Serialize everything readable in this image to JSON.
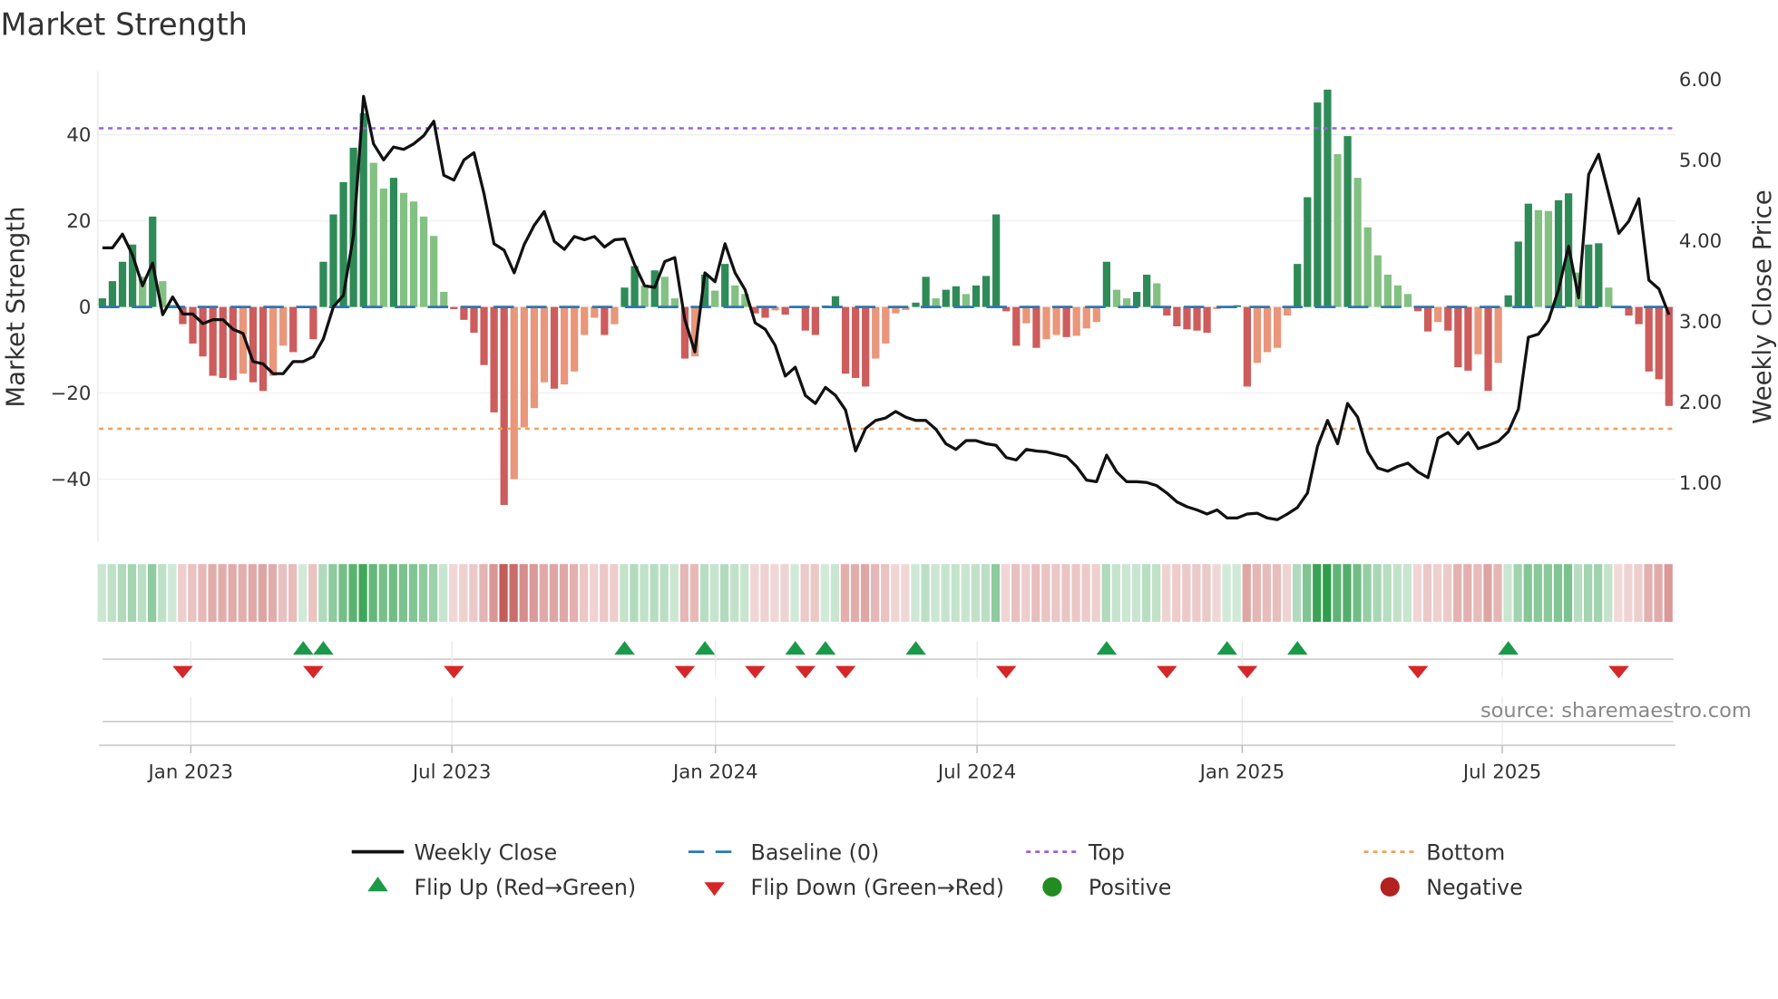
{
  "chart_data": {
    "type": "bar",
    "title": "Market Strength",
    "ylabel": "Market Strength",
    "y2label": "Weekly Close Price",
    "ylim": [
      -55,
      54
    ],
    "y2lim": [
      0.25,
      6.2
    ],
    "y_ticks": [
      "40",
      "20",
      "0",
      "−20",
      "−40"
    ],
    "y_tick_values": [
      40,
      20,
      0,
      -20,
      -40
    ],
    "y2_ticks": [
      "6.00",
      "5.00",
      "4.00",
      "3.00",
      "2.00",
      "1.00"
    ],
    "y2_tick_values": [
      6,
      5,
      4,
      3,
      2,
      1
    ],
    "x_unit": "week index",
    "x_ticks": [
      {
        "label": "Jan 2023",
        "week": 8.8
      },
      {
        "label": "Jul 2023",
        "week": 34.8
      },
      {
        "label": "Jan 2024",
        "week": 61.05
      },
      {
        "label": "Jul 2024",
        "week": 87.1
      },
      {
        "label": "Jan 2025",
        "week": 113.5
      },
      {
        "label": "Jul 2025",
        "week": 139.4
      }
    ],
    "top_level": 41.5,
    "bottom_level": -28.3,
    "baseline": 0,
    "strength": [
      2,
      6,
      10.5,
      14.5,
      7,
      21,
      6,
      0.5,
      -4,
      -8.5,
      -11.5,
      -16,
      -16.5,
      -17,
      -15.5,
      -17.5,
      -19.5,
      -16,
      -9,
      -10.5,
      0.2,
      -7.5,
      10.5,
      21.5,
      29,
      37,
      45,
      33.5,
      27.5,
      30,
      26.5,
      24.5,
      21,
      16.5,
      3.5,
      -0.5,
      -3,
      -6,
      -13.5,
      -24.5,
      -46,
      -40,
      -28,
      -23.5,
      -17.5,
      -19,
      -18,
      -15,
      -6.5,
      -2.5,
      -6.5,
      -4,
      4.5,
      9.5,
      5,
      8.5,
      7,
      2,
      -12,
      -11.5,
      7.5,
      3.8,
      10,
      5,
      3,
      -1.5,
      -2.5,
      -0.8,
      -1.8,
      0,
      -5.5,
      -6.5,
      0.3,
      2.5,
      -15.5,
      -16.5,
      -18.5,
      -12,
      -8.5,
      -1.5,
      -0.7,
      1,
      7,
      2,
      4,
      4.8,
      3,
      5,
      7.2,
      21.5,
      -1,
      -9,
      -3.8,
      -9.5,
      -7.5,
      -6.5,
      -7,
      -6.7,
      -5,
      -3.5,
      10.5,
      4,
      2,
      3.5,
      7.5,
      5.5,
      -2,
      -4.5,
      -5.2,
      -5.5,
      -6,
      -0.5,
      0,
      0.4,
      -18.5,
      -13,
      -10.5,
      -9.5,
      -2,
      10,
      25.5,
      47.5,
      50.5,
      35.5,
      39.7,
      30,
      18.5,
      12,
      7.5,
      5,
      3,
      -1,
      -5.7,
      -3.5,
      -5.5,
      -14,
      -14.8,
      -11,
      -19.5,
      -13,
      2.7,
      15.2,
      24,
      22.5,
      22.3,
      24.8,
      26.4,
      8,
      14.5,
      14.8,
      4.5,
      -0.2,
      -2,
      -4,
      -15,
      -16.8,
      -23
    ],
    "weekly_close": [
      3.91,
      3.91,
      4.08,
      3.82,
      3.44,
      3.72,
      3.08,
      3.3,
      3.09,
      3.09,
      2.97,
      3.02,
      3.02,
      2.9,
      2.85,
      2.5,
      2.47,
      2.35,
      2.35,
      2.5,
      2.5,
      2.56,
      2.78,
      3.18,
      3.32,
      4.06,
      5.79,
      5.2,
      5.0,
      5.16,
      5.13,
      5.2,
      5.3,
      5.48,
      4.81,
      4.75,
      5.0,
      5.09,
      4.58,
      3.96,
      3.88,
      3.6,
      3.95,
      4.19,
      4.36,
      3.99,
      3.89,
      4.05,
      4.01,
      4.05,
      3.92,
      4.01,
      4.02,
      3.7,
      3.44,
      3.42,
      3.74,
      3.79,
      3.02,
      2.62,
      3.6,
      3.49,
      3.96,
      3.6,
      3.39,
      2.98,
      2.9,
      2.7,
      2.32,
      2.43,
      2.08,
      1.98,
      2.18,
      2.08,
      1.9,
      1.39,
      1.67,
      1.77,
      1.8,
      1.88,
      1.81,
      1.77,
      1.77,
      1.66,
      1.48,
      1.41,
      1.52,
      1.52,
      1.48,
      1.46,
      1.31,
      1.28,
      1.41,
      1.39,
      1.38,
      1.35,
      1.32,
      1.2,
      1.03,
      1.01,
      1.34,
      1.13,
      1.01,
      1.01,
      1.0,
      0.96,
      0.87,
      0.76,
      0.7,
      0.66,
      0.61,
      0.66,
      0.56,
      0.56,
      0.61,
      0.62,
      0.56,
      0.54,
      0.61,
      0.69,
      0.87,
      1.45,
      1.77,
      1.48,
      1.98,
      1.81,
      1.38,
      1.18,
      1.14,
      1.2,
      1.24,
      1.13,
      1.06,
      1.55,
      1.62,
      1.48,
      1.62,
      1.42,
      1.46,
      1.51,
      1.63,
      1.91,
      2.8,
      2.84,
      3.01,
      3.39,
      3.93,
      3.29,
      4.82,
      5.07,
      4.58,
      4.09,
      4.24,
      4.52,
      3.51,
      3.4,
      3.08
    ],
    "flip_up_weeks": [
      20,
      22,
      52,
      60,
      69,
      72,
      81,
      100,
      112,
      119,
      140
    ],
    "flip_down_weeks": [
      8,
      21,
      35,
      58,
      65,
      70,
      74,
      90,
      106,
      114,
      131,
      151
    ],
    "legend": {
      "placement": "bottom",
      "items": [
        {
          "label": "Weekly Close",
          "kind": "line-solid",
          "color": "#111111"
        },
        {
          "label": "Baseline (0)",
          "kind": "line-dashed",
          "color": "#2a77b4"
        },
        {
          "label": "Top",
          "kind": "line-dotted",
          "color": "#9b5fe0"
        },
        {
          "label": "Bottom",
          "kind": "line-dotted",
          "color": "#f0a060"
        },
        {
          "label": "Flip Up (Red→Green)",
          "kind": "triangle-up",
          "color": "#1a9a48"
        },
        {
          "label": "Flip Down (Green→Red)",
          "kind": "triangle-down",
          "color": "#d62728"
        },
        {
          "label": "Positive",
          "kind": "circle",
          "color": "#228b22"
        },
        {
          "label": "Negative",
          "kind": "circle",
          "color": "#b22222"
        }
      ]
    },
    "colors": {
      "pos_strong": "#2e8b57",
      "pos_weak": "#82c182",
      "neg_strong": "#cd5c5c",
      "neg_weak": "#e9967a",
      "heat_pos": "#2f9e4c",
      "heat_neg": "#c0504d",
      "close_line": "#111111",
      "baseline": "#2a77b4",
      "top": "#9b5fe0",
      "bottom": "#f0a060"
    }
  },
  "source": "source: sharemaestro.com"
}
